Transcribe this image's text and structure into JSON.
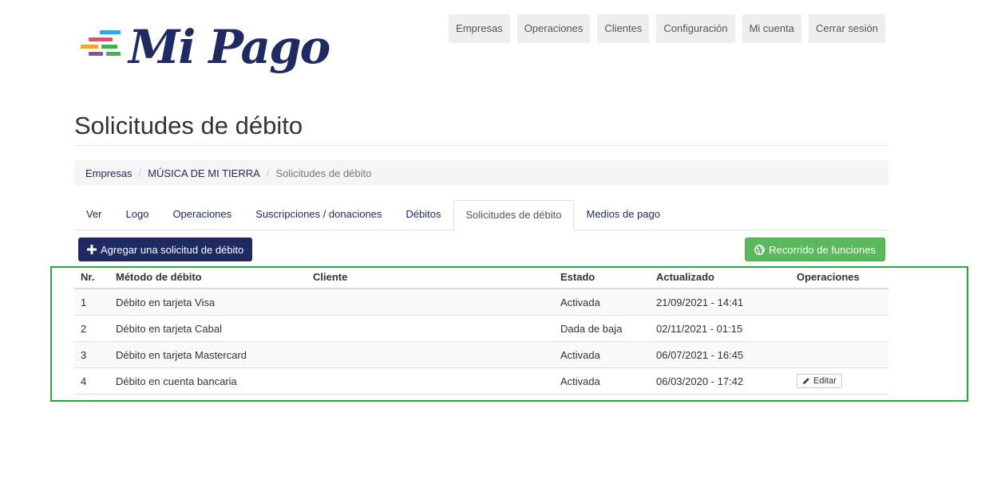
{
  "brand": {
    "name": "Mi Pago",
    "stripe_colors": [
      "#2fa8e0",
      "#e94b6a",
      "#f6a623",
      "#8a4fa3",
      "#3ab54a"
    ]
  },
  "topnav": [
    "Empresas",
    "Operaciones",
    "Clientes",
    "Configuración",
    "Mi cuenta",
    "Cerrar sesión"
  ],
  "page": {
    "title": "Solicitudes de débito"
  },
  "breadcrumb": {
    "items": [
      "Empresas",
      "MÚSICA DE MI TIERRA"
    ],
    "current": "Solicitudes de débito",
    "separator": "/"
  },
  "tabs": {
    "items": [
      "Ver",
      "Logo",
      "Operaciones",
      "Suscripciones / donaciones",
      "Débitos",
      "Solicitudes de débito",
      "Medios de pago"
    ],
    "active": 5
  },
  "actions": {
    "add_label": "Agregar una solicitud de débito",
    "add_icon": "plus-icon",
    "tour_label": "Recorrido de funciones",
    "tour_icon": "globe-icon"
  },
  "table": {
    "headers": [
      "Nr.",
      "Método de débito",
      "Cliente",
      "Estado",
      "Actualizado",
      "Operaciones"
    ],
    "rows": [
      {
        "nr": "1",
        "method": "Débito en tarjeta Visa",
        "client": "",
        "status": "Activada",
        "updated": "21/09/2021 - 14:41",
        "edit": ""
      },
      {
        "nr": "2",
        "method": "Débito en tarjeta Cabal",
        "client": "",
        "status": "Dada de baja",
        "updated": "02/11/2021 - 01:15",
        "edit": ""
      },
      {
        "nr": "3",
        "method": "Débito en tarjeta Mastercard",
        "client": "",
        "status": "Activada",
        "updated": "06/07/2021 - 16:45",
        "edit": ""
      },
      {
        "nr": "4",
        "method": "Débito en cuenta bancaria",
        "client": "",
        "status": "Activada",
        "updated": "06/03/2020 - 17:42",
        "edit": "Editar"
      }
    ]
  },
  "colors": {
    "brand_navy": "#1f2a63",
    "tour_green": "#5cb85c",
    "highlight_green": "#28a745"
  }
}
